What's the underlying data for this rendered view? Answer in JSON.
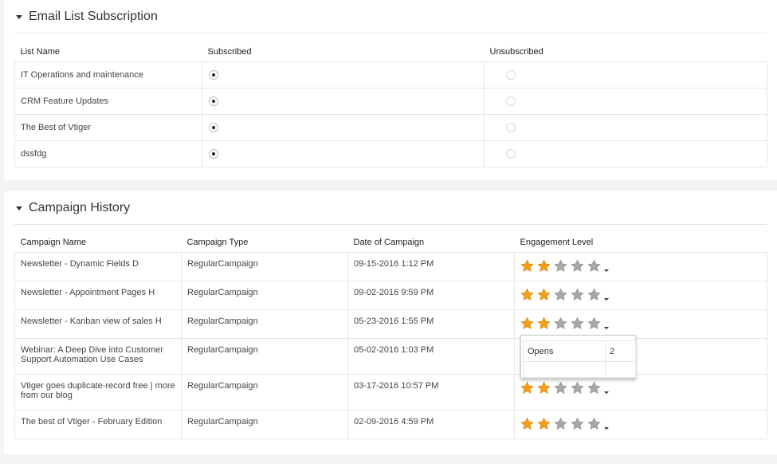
{
  "email_section": {
    "title": "Email List Subscription",
    "columns": [
      "List Name",
      "Subscribed",
      "Unsubscribed"
    ],
    "rows": [
      {
        "name": "IT Operations and maintenance",
        "subscribed": true
      },
      {
        "name": "CRM Feature Updates",
        "subscribed": true
      },
      {
        "name": "The Best of Vtiger",
        "subscribed": true
      },
      {
        "name": "dssfdg",
        "subscribed": true
      }
    ]
  },
  "campaign_section": {
    "title": "Campaign History",
    "columns": [
      "Campaign Name",
      "Campaign Type",
      "Date of Campaign",
      "Engagement Level"
    ],
    "rows": [
      {
        "name": "Newsletter - Dynamic Fields D",
        "type": "RegularCampaign",
        "date": "09-15-2016 1:12 PM",
        "stars": 2
      },
      {
        "name": "Newsletter - Appointment Pages H",
        "type": "RegularCampaign",
        "date": "09-02-2016 9:59 PM",
        "stars": 2
      },
      {
        "name": "Newsletter - Kanban view of sales H",
        "type": "RegularCampaign",
        "date": "05-23-2016 1:55 PM",
        "stars": 2
      },
      {
        "name": "Webinar: A Deep Dive into Customer Support Automation Use Cases",
        "type": "RegularCampaign",
        "date": "05-02-2016 1:03 PM",
        "stars": 0
      },
      {
        "name": "Vtiger goes duplicate-record free | more from our blog",
        "type": "RegularCampaign",
        "date": "03-17-2016 10:57 PM",
        "stars": 2
      },
      {
        "name": "The best of Vtiger - February Edition",
        "type": "RegularCampaign",
        "date": "02-09-2016 4:59 PM",
        "stars": 2
      }
    ],
    "max_stars": 5
  },
  "popover": {
    "label": "Opens",
    "value": "2"
  },
  "colors": {
    "star_filled": "#f5a01a",
    "star_empty": "#a8a8a8"
  },
  "icons": {
    "section_toggle": "caret-down-icon",
    "star": "star-icon",
    "dropdown": "chevron-down-icon"
  }
}
